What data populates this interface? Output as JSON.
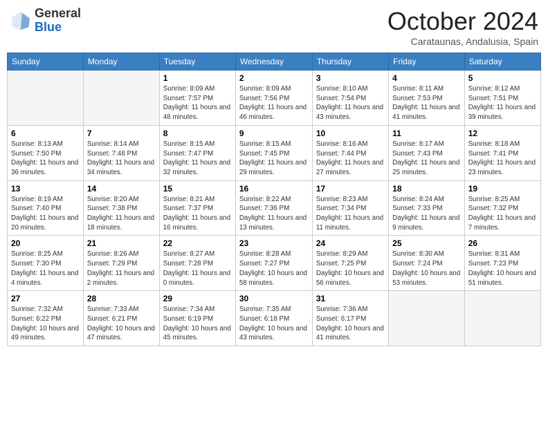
{
  "header": {
    "logo_general": "General",
    "logo_blue": "Blue",
    "month_title": "October 2024",
    "subtitle": "Carataunas, Andalusia, Spain"
  },
  "weekdays": [
    "Sunday",
    "Monday",
    "Tuesday",
    "Wednesday",
    "Thursday",
    "Friday",
    "Saturday"
  ],
  "weeks": [
    [
      {
        "day": "",
        "info": ""
      },
      {
        "day": "",
        "info": ""
      },
      {
        "day": "1",
        "info": "Sunrise: 8:09 AM\nSunset: 7:57 PM\nDaylight: 11 hours and 48 minutes."
      },
      {
        "day": "2",
        "info": "Sunrise: 8:09 AM\nSunset: 7:56 PM\nDaylight: 11 hours and 46 minutes."
      },
      {
        "day": "3",
        "info": "Sunrise: 8:10 AM\nSunset: 7:54 PM\nDaylight: 11 hours and 43 minutes."
      },
      {
        "day": "4",
        "info": "Sunrise: 8:11 AM\nSunset: 7:53 PM\nDaylight: 11 hours and 41 minutes."
      },
      {
        "day": "5",
        "info": "Sunrise: 8:12 AM\nSunset: 7:51 PM\nDaylight: 11 hours and 39 minutes."
      }
    ],
    [
      {
        "day": "6",
        "info": "Sunrise: 8:13 AM\nSunset: 7:50 PM\nDaylight: 11 hours and 36 minutes."
      },
      {
        "day": "7",
        "info": "Sunrise: 8:14 AM\nSunset: 7:48 PM\nDaylight: 11 hours and 34 minutes."
      },
      {
        "day": "8",
        "info": "Sunrise: 8:15 AM\nSunset: 7:47 PM\nDaylight: 11 hours and 32 minutes."
      },
      {
        "day": "9",
        "info": "Sunrise: 8:15 AM\nSunset: 7:45 PM\nDaylight: 11 hours and 29 minutes."
      },
      {
        "day": "10",
        "info": "Sunrise: 8:16 AM\nSunset: 7:44 PM\nDaylight: 11 hours and 27 minutes."
      },
      {
        "day": "11",
        "info": "Sunrise: 8:17 AM\nSunset: 7:43 PM\nDaylight: 11 hours and 25 minutes."
      },
      {
        "day": "12",
        "info": "Sunrise: 8:18 AM\nSunset: 7:41 PM\nDaylight: 11 hours and 23 minutes."
      }
    ],
    [
      {
        "day": "13",
        "info": "Sunrise: 8:19 AM\nSunset: 7:40 PM\nDaylight: 11 hours and 20 minutes."
      },
      {
        "day": "14",
        "info": "Sunrise: 8:20 AM\nSunset: 7:38 PM\nDaylight: 11 hours and 18 minutes."
      },
      {
        "day": "15",
        "info": "Sunrise: 8:21 AM\nSunset: 7:37 PM\nDaylight: 11 hours and 16 minutes."
      },
      {
        "day": "16",
        "info": "Sunrise: 8:22 AM\nSunset: 7:36 PM\nDaylight: 11 hours and 13 minutes."
      },
      {
        "day": "17",
        "info": "Sunrise: 8:23 AM\nSunset: 7:34 PM\nDaylight: 11 hours and 11 minutes."
      },
      {
        "day": "18",
        "info": "Sunrise: 8:24 AM\nSunset: 7:33 PM\nDaylight: 11 hours and 9 minutes."
      },
      {
        "day": "19",
        "info": "Sunrise: 8:25 AM\nSunset: 7:32 PM\nDaylight: 11 hours and 7 minutes."
      }
    ],
    [
      {
        "day": "20",
        "info": "Sunrise: 8:25 AM\nSunset: 7:30 PM\nDaylight: 11 hours and 4 minutes."
      },
      {
        "day": "21",
        "info": "Sunrise: 8:26 AM\nSunset: 7:29 PM\nDaylight: 11 hours and 2 minutes."
      },
      {
        "day": "22",
        "info": "Sunrise: 8:27 AM\nSunset: 7:28 PM\nDaylight: 11 hours and 0 minutes."
      },
      {
        "day": "23",
        "info": "Sunrise: 8:28 AM\nSunset: 7:27 PM\nDaylight: 10 hours and 58 minutes."
      },
      {
        "day": "24",
        "info": "Sunrise: 8:29 AM\nSunset: 7:25 PM\nDaylight: 10 hours and 56 minutes."
      },
      {
        "day": "25",
        "info": "Sunrise: 8:30 AM\nSunset: 7:24 PM\nDaylight: 10 hours and 53 minutes."
      },
      {
        "day": "26",
        "info": "Sunrise: 8:31 AM\nSunset: 7:23 PM\nDaylight: 10 hours and 51 minutes."
      }
    ],
    [
      {
        "day": "27",
        "info": "Sunrise: 7:32 AM\nSunset: 6:22 PM\nDaylight: 10 hours and 49 minutes."
      },
      {
        "day": "28",
        "info": "Sunrise: 7:33 AM\nSunset: 6:21 PM\nDaylight: 10 hours and 47 minutes."
      },
      {
        "day": "29",
        "info": "Sunrise: 7:34 AM\nSunset: 6:19 PM\nDaylight: 10 hours and 45 minutes."
      },
      {
        "day": "30",
        "info": "Sunrise: 7:35 AM\nSunset: 6:18 PM\nDaylight: 10 hours and 43 minutes."
      },
      {
        "day": "31",
        "info": "Sunrise: 7:36 AM\nSunset: 6:17 PM\nDaylight: 10 hours and 41 minutes."
      },
      {
        "day": "",
        "info": ""
      },
      {
        "day": "",
        "info": ""
      }
    ]
  ]
}
